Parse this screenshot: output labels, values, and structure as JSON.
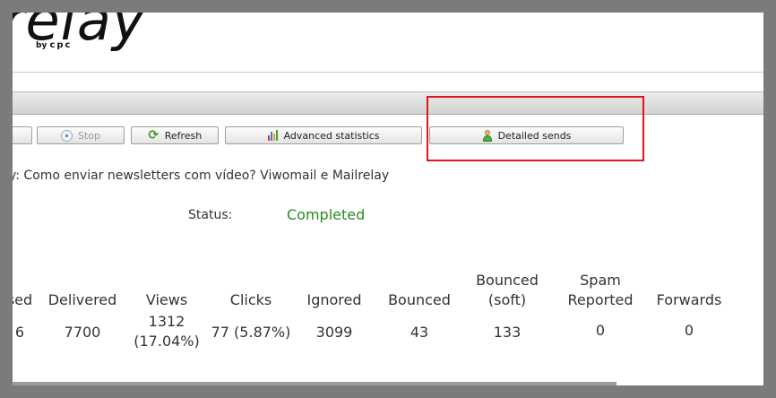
{
  "header": {
    "logo_text": "relay",
    "logo_sub_by": "by",
    "logo_sub_brand": "cpc"
  },
  "toolbar": {
    "stop_label": "Stop",
    "refresh_label": "Refresh",
    "advanced_statistics_label": "Advanced statistics",
    "detailed_sends_label": "Detailed sends"
  },
  "campaign": {
    "title": "y: Como enviar newsletters com vídeo? Viwomail e Mailrelay",
    "status_label": "Status:",
    "status_value": "Completed",
    "status_color": "#2a8a22"
  },
  "stats": {
    "headers": [
      "sed",
      "Delivered",
      "Views",
      "Clicks",
      "Ignored",
      "Bounced",
      "Bounced\n(soft)",
      "Spam\nReported",
      "Forwards"
    ],
    "values": [
      "6",
      "7700",
      "1312\n(17.04%)",
      "77 (5.87%)",
      "3099",
      "43",
      "133",
      "0",
      "0"
    ]
  },
  "icons": {
    "stop": "stop-icon",
    "refresh": "refresh-icon",
    "advanced_statistics": "bar-chart-icon",
    "detailed_sends": "user-icon"
  },
  "colors": {
    "highlight": "#e0141e"
  }
}
